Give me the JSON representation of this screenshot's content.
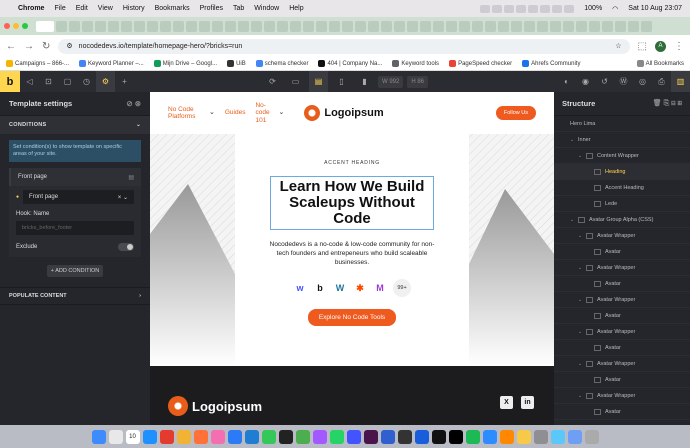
{
  "menubar": {
    "apple": "",
    "app_name": "Chrome",
    "items": [
      "File",
      "Edit",
      "View",
      "History",
      "Bookmarks",
      "Profiles",
      "Tab",
      "Window",
      "Help"
    ],
    "battery": "100%",
    "datetime": "Sat 10 Aug  23:07"
  },
  "address": {
    "url": "nocodedevs.io/template/homepage-hero/?bricks=run",
    "avatar_letter": "A"
  },
  "bookmarks": {
    "items": [
      "Campaigns – 866-...",
      "Keyword Planner –...",
      "Mijn Drive – Googl...",
      "UiB",
      "schema checker",
      "404 | Company Na...",
      "Keyword tools",
      "PageSpeed checker",
      "Ahrefs Community"
    ],
    "all_label": "All Bookmarks"
  },
  "toolbar": {
    "logo": "b",
    "width_value": "992",
    "height_placeholder": "86"
  },
  "left_panel": {
    "title": "Template settings",
    "conditions_heading": "CONDITIONS",
    "note": "Set condition(s) to show template on specific areas of your site.",
    "condition_title": "Front page",
    "select_value": "Front page",
    "hook_label": "Hook: Name",
    "hook_placeholder": "bricks_before_footer",
    "exclude_label": "Exclude",
    "add_condition": "+ ADD CONDITION",
    "populate_heading": "POPULATE CONTENT"
  },
  "site": {
    "nav": [
      {
        "label": "No Code Platforms",
        "has_menu": true
      },
      {
        "label": "Guides",
        "has_menu": false
      },
      {
        "label": "No-code 101",
        "has_menu": true
      }
    ],
    "logo_text": "Logoipsum",
    "follow_button": "Follow Us",
    "accent_heading": "ACCENT HEADING",
    "heading": "Learn How We Build Scaleups Without Code",
    "lede": "Nocodedevs is a no-code & low-code community for non-tech founders and entrepeneurs who build scaleable businesses.",
    "tools": [
      {
        "name": "webflow",
        "glyph": "w",
        "color": "#4353ff"
      },
      {
        "name": "bubble",
        "glyph": "b",
        "color": "#111111"
      },
      {
        "name": "wordpress",
        "glyph": "W",
        "color": "#21759b"
      },
      {
        "name": "zapier",
        "glyph": "✱",
        "color": "#ff4a00"
      },
      {
        "name": "make",
        "glyph": "M",
        "color": "#9b3ad9"
      }
    ],
    "tools_more": "99+",
    "cta": "Explore No Code Tools",
    "footer_logo": "Logoipsum",
    "social": [
      "X",
      "in"
    ]
  },
  "structure": {
    "title": "Structure",
    "rows": [
      {
        "label": "Hero Lima",
        "depth": 0,
        "caret": false,
        "icon": false,
        "active": false
      },
      {
        "label": "Inner",
        "depth": 1,
        "caret": true,
        "icon": false,
        "active": false
      },
      {
        "label": "Content Wrapper",
        "depth": 2,
        "caret": true,
        "icon": true,
        "active": false
      },
      {
        "label": "Heading",
        "depth": 3,
        "caret": false,
        "icon": true,
        "active": true
      },
      {
        "label": "Accent Heading",
        "depth": 3,
        "caret": false,
        "icon": true,
        "active": false
      },
      {
        "label": "Lede",
        "depth": 3,
        "caret": false,
        "icon": true,
        "active": false
      },
      {
        "label": "Avatar Group Alpha (CSS)",
        "depth": 1,
        "caret": true,
        "icon": true,
        "active": false
      },
      {
        "label": "Avatar Wrapper",
        "depth": 2,
        "caret": true,
        "icon": true,
        "active": false
      },
      {
        "label": "Avatar",
        "depth": 3,
        "caret": false,
        "icon": true,
        "active": false
      },
      {
        "label": "Avatar Wrapper",
        "depth": 2,
        "caret": true,
        "icon": true,
        "active": false
      },
      {
        "label": "Avatar",
        "depth": 3,
        "caret": false,
        "icon": true,
        "active": false
      },
      {
        "label": "Avatar Wrapper",
        "depth": 2,
        "caret": true,
        "icon": true,
        "active": false
      },
      {
        "label": "Avatar",
        "depth": 3,
        "caret": false,
        "icon": true,
        "active": false
      },
      {
        "label": "Avatar Wrapper",
        "depth": 2,
        "caret": true,
        "icon": true,
        "active": false
      },
      {
        "label": "Avatar",
        "depth": 3,
        "caret": false,
        "icon": true,
        "active": false
      },
      {
        "label": "Avatar Wrapper",
        "depth": 2,
        "caret": true,
        "icon": true,
        "active": false
      },
      {
        "label": "Avatar",
        "depth": 3,
        "caret": false,
        "icon": true,
        "active": false
      },
      {
        "label": "Avatar Wrapper",
        "depth": 2,
        "caret": true,
        "icon": true,
        "active": false
      },
      {
        "label": "Avatar",
        "depth": 3,
        "caret": false,
        "icon": true,
        "active": false
      }
    ]
  },
  "dock": {
    "calendar_day": "10",
    "apps": [
      "finder",
      "launchpad",
      "calendar",
      "safari",
      "chrome",
      "chrome-canary",
      "firefox",
      "photos",
      "appstore",
      "vscode",
      "messages",
      "notion",
      "maps",
      "figma",
      "whatsapp",
      "webflow",
      "slack",
      "spark",
      "terminal",
      "bitwarden",
      "github",
      "inkscape",
      "spotify",
      "zoom",
      "vlc",
      "tableplus",
      "settings",
      "finder2",
      "preview",
      "trash"
    ]
  },
  "colors": {
    "accent": "#ef5a1f",
    "bricks_yellow": "#ffd64f",
    "panel_bg": "#25262b"
  }
}
